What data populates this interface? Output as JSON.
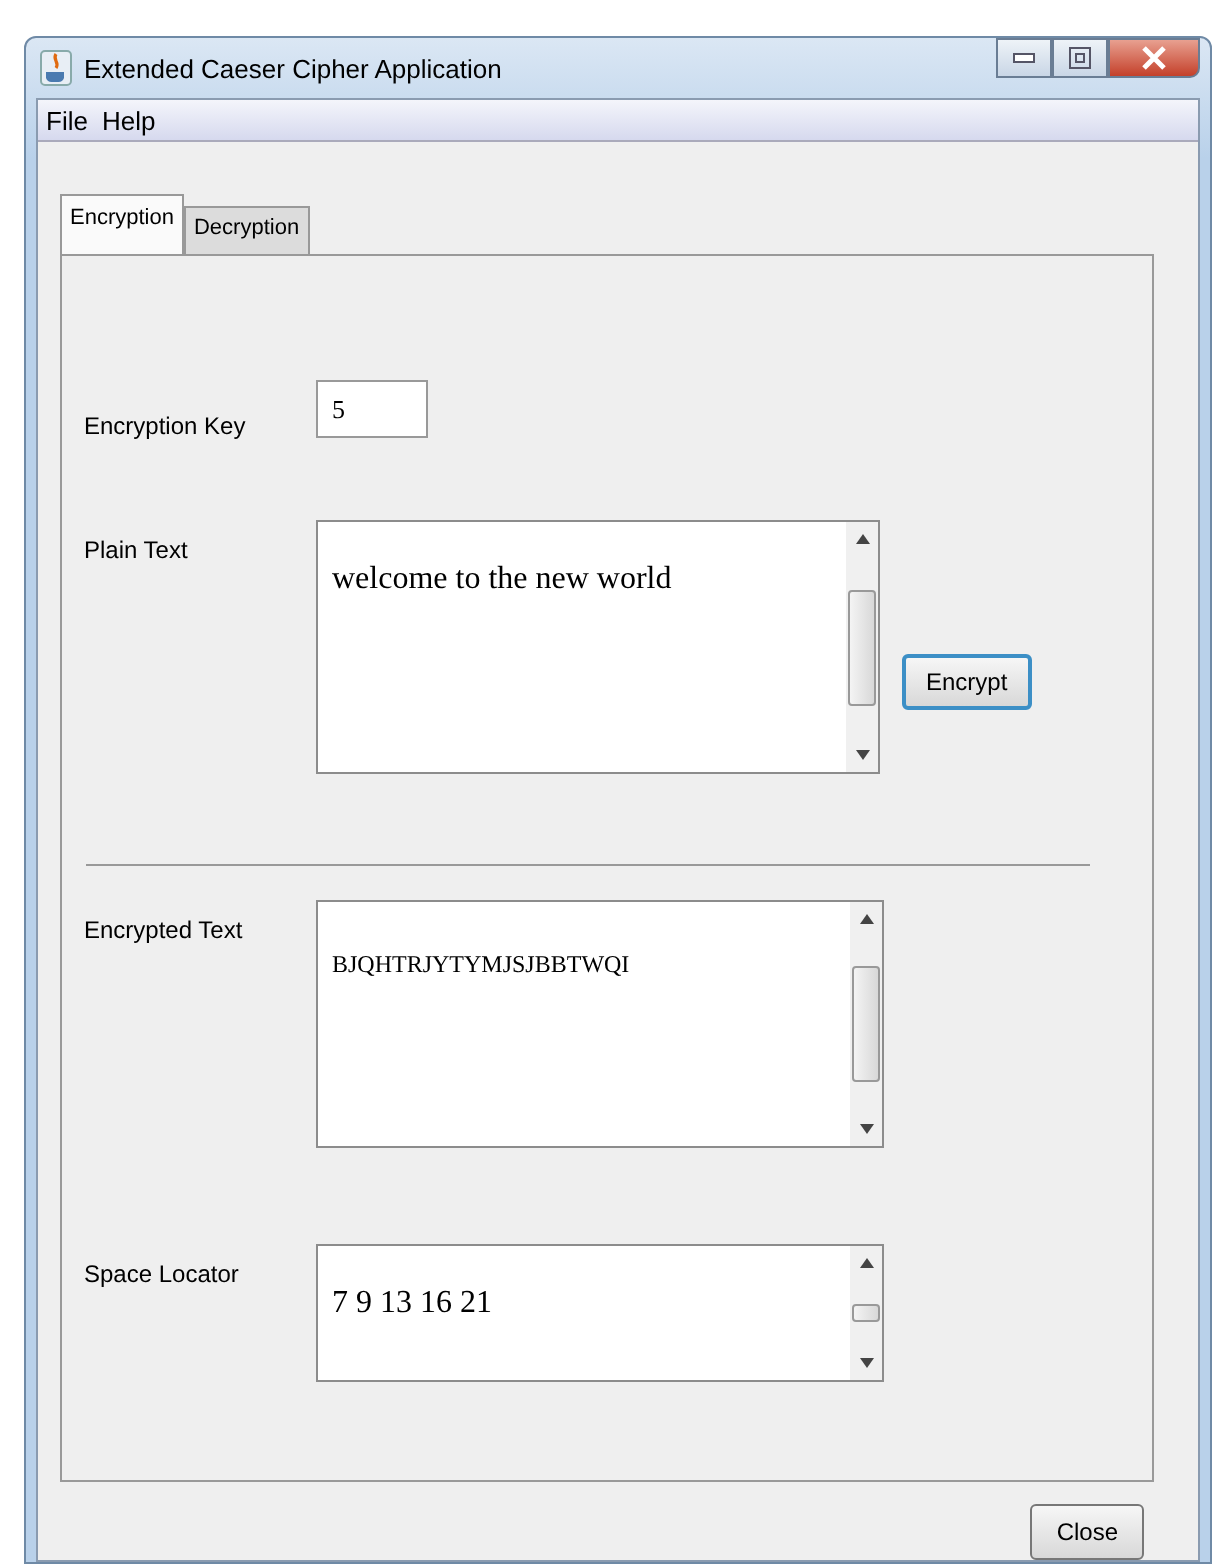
{
  "window": {
    "title": "Extended Caeser Cipher Application"
  },
  "menu": [
    "File",
    "Help"
  ],
  "tabs": [
    {
      "label": "Encryption",
      "selected": true
    },
    {
      "label": "Decryption",
      "selected": false
    }
  ],
  "key": {
    "label": "Encryption Key",
    "value": "5"
  },
  "plain_text": {
    "label": "Plain Text",
    "value": "welcome to the new world",
    "button": "Encrypt"
  },
  "encrypted_text": {
    "label": "Encrypted Text",
    "value": "BJQHTRJYTYMJSJBBTWQI"
  },
  "space_locator": {
    "label": "Space Locator",
    "value": "7 9 13 16 21"
  },
  "close_button": "Close"
}
